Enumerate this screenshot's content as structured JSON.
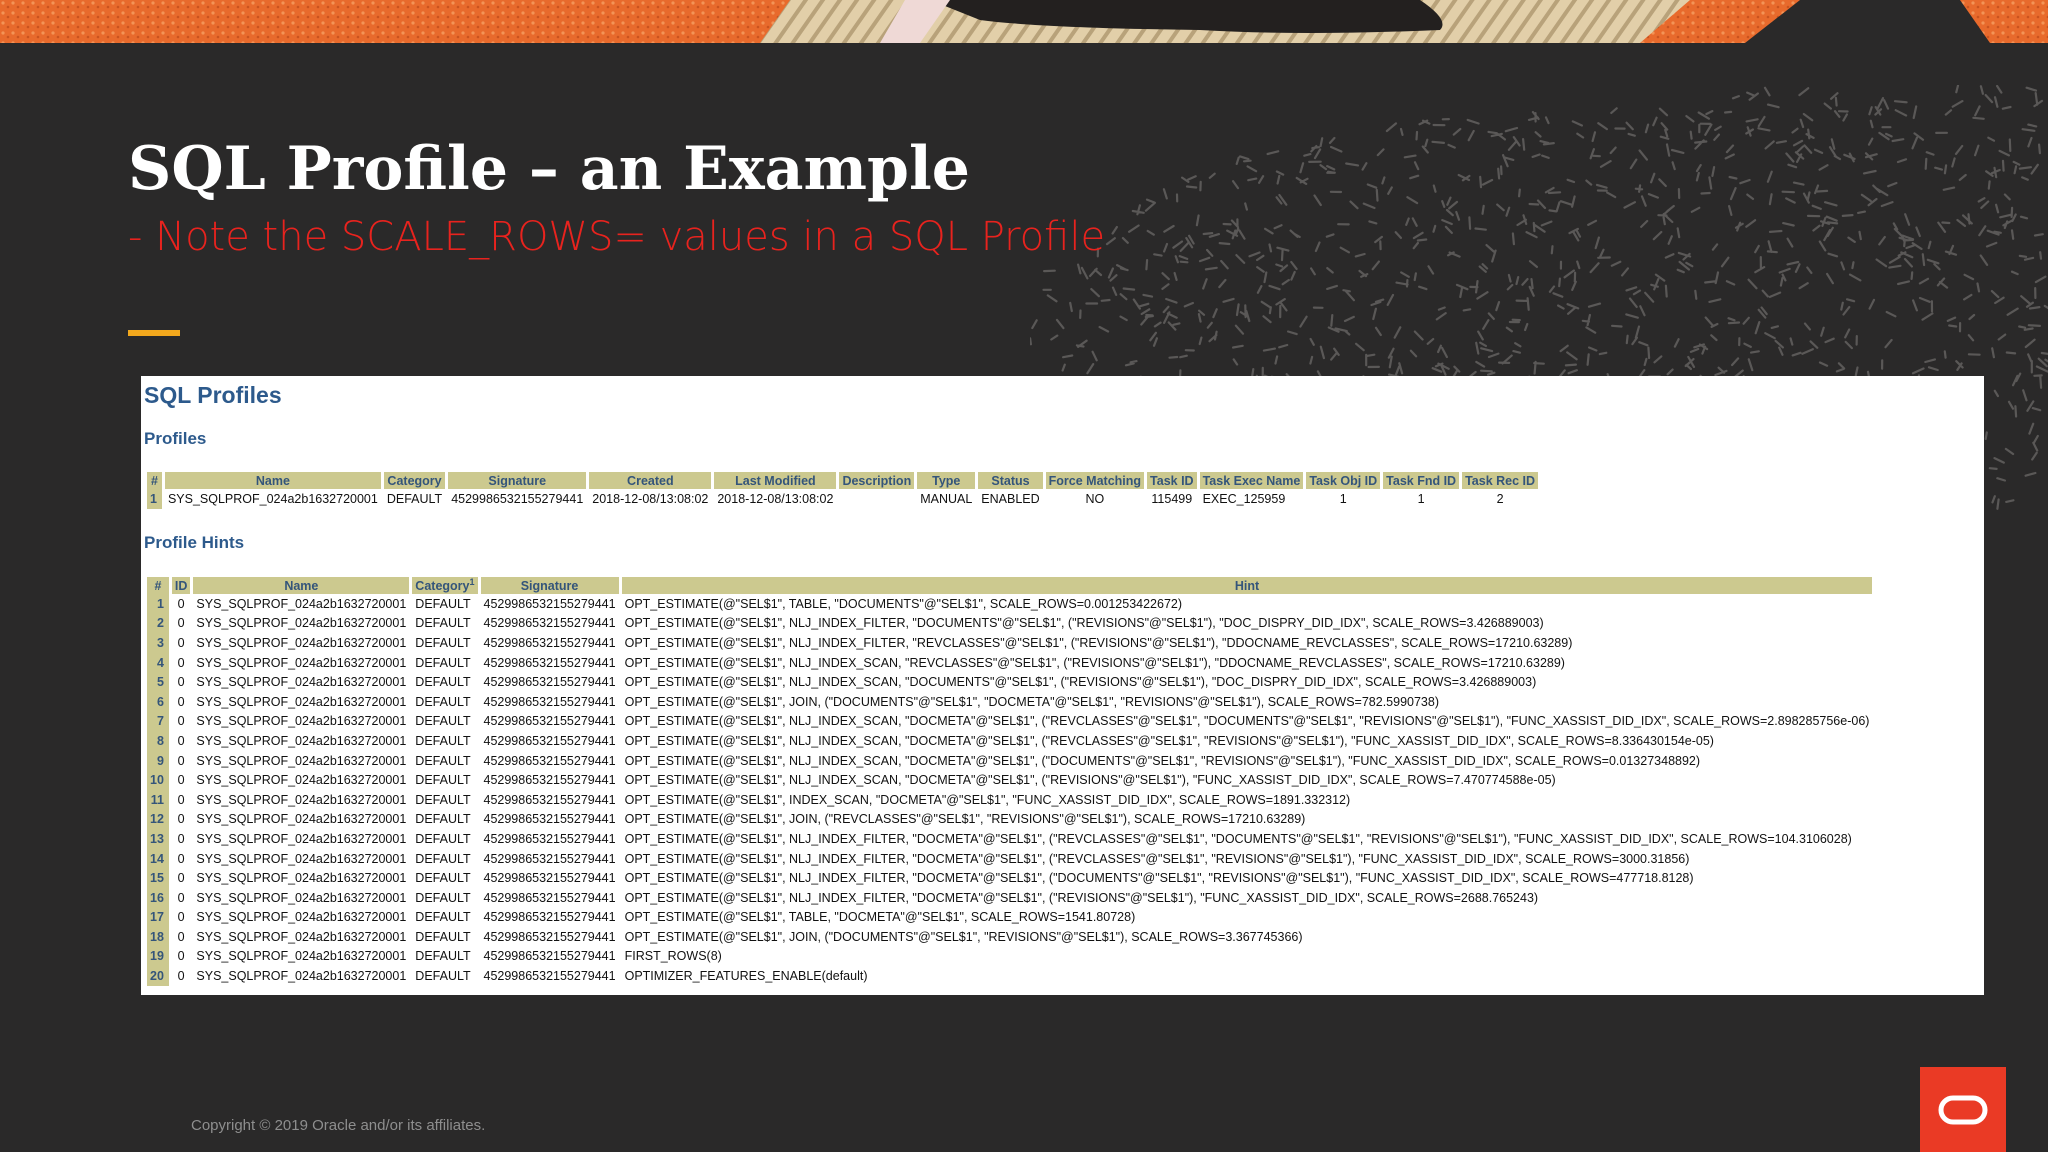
{
  "slide": {
    "title": "SQL Profile – an Example",
    "subtitle": "- Note the SCALE_ROWS= values in a SQL Profile",
    "footer": "Copyright © 2019 Oracle and/or its affiliates.",
    "accent_color": "#f2a81d",
    "subtitle_color": "#e8231e",
    "logo_icon": "oracle-logo-icon"
  },
  "panel": {
    "title": "SQL Profiles",
    "profiles_section": "Profiles",
    "hints_section": "Profile Hints"
  },
  "profiles": {
    "columns": [
      "#",
      "Name",
      "Category",
      "Signature",
      "Created",
      "Last Modified",
      "Description",
      "Type",
      "Status",
      "Force Matching",
      "Task ID",
      "Task Exec Name",
      "Task Obj ID",
      "Task Fnd ID",
      "Task Rec ID"
    ],
    "rows": [
      [
        "1",
        "SYS_SQLPROF_024a2b1632720001",
        "DEFAULT",
        "4529986532155279441",
        "2018-12-08/13:08:02",
        "2018-12-08/13:08:02",
        "",
        "MANUAL",
        "ENABLED",
        "NO",
        "115499",
        "EXEC_125959",
        "1",
        "1",
        "2"
      ]
    ]
  },
  "hints": {
    "columns": [
      "#",
      "ID",
      "Name",
      "Category",
      "Signature",
      "Hint"
    ],
    "category_footnote": "1",
    "rows": [
      [
        "1",
        "0",
        "SYS_SQLPROF_024a2b1632720001",
        "DEFAULT",
        "4529986532155279441",
        "OPT_ESTIMATE(@\"SEL$1\", TABLE, \"DOCUMENTS\"@\"SEL$1\", SCALE_ROWS=0.001253422672)"
      ],
      [
        "2",
        "0",
        "SYS_SQLPROF_024a2b1632720001",
        "DEFAULT",
        "4529986532155279441",
        "OPT_ESTIMATE(@\"SEL$1\", NLJ_INDEX_FILTER, \"DOCUMENTS\"@\"SEL$1\", (\"REVISIONS\"@\"SEL$1\"), \"DOC_DISPRY_DID_IDX\", SCALE_ROWS=3.426889003)"
      ],
      [
        "3",
        "0",
        "SYS_SQLPROF_024a2b1632720001",
        "DEFAULT",
        "4529986532155279441",
        "OPT_ESTIMATE(@\"SEL$1\", NLJ_INDEX_FILTER, \"REVCLASSES\"@\"SEL$1\", (\"REVISIONS\"@\"SEL$1\"), \"DDOCNAME_REVCLASSES\", SCALE_ROWS=17210.63289)"
      ],
      [
        "4",
        "0",
        "SYS_SQLPROF_024a2b1632720001",
        "DEFAULT",
        "4529986532155279441",
        "OPT_ESTIMATE(@\"SEL$1\", NLJ_INDEX_SCAN, \"REVCLASSES\"@\"SEL$1\", (\"REVISIONS\"@\"SEL$1\"), \"DDOCNAME_REVCLASSES\", SCALE_ROWS=17210.63289)"
      ],
      [
        "5",
        "0",
        "SYS_SQLPROF_024a2b1632720001",
        "DEFAULT",
        "4529986532155279441",
        "OPT_ESTIMATE(@\"SEL$1\", NLJ_INDEX_SCAN, \"DOCUMENTS\"@\"SEL$1\", (\"REVISIONS\"@\"SEL$1\"), \"DOC_DISPRY_DID_IDX\", SCALE_ROWS=3.426889003)"
      ],
      [
        "6",
        "0",
        "SYS_SQLPROF_024a2b1632720001",
        "DEFAULT",
        "4529986532155279441",
        "OPT_ESTIMATE(@\"SEL$1\", JOIN, (\"DOCUMENTS\"@\"SEL$1\", \"DOCMETA\"@\"SEL$1\", \"REVISIONS\"@\"SEL$1\"), SCALE_ROWS=782.5990738)"
      ],
      [
        "7",
        "0",
        "SYS_SQLPROF_024a2b1632720001",
        "DEFAULT",
        "4529986532155279441",
        "OPT_ESTIMATE(@\"SEL$1\", NLJ_INDEX_SCAN, \"DOCMETA\"@\"SEL$1\", (\"REVCLASSES\"@\"SEL$1\", \"DOCUMENTS\"@\"SEL$1\", \"REVISIONS\"@\"SEL$1\"), \"FUNC_XASSIST_DID_IDX\", SCALE_ROWS=2.898285756e-06)"
      ],
      [
        "8",
        "0",
        "SYS_SQLPROF_024a2b1632720001",
        "DEFAULT",
        "4529986532155279441",
        "OPT_ESTIMATE(@\"SEL$1\", NLJ_INDEX_SCAN, \"DOCMETA\"@\"SEL$1\", (\"REVCLASSES\"@\"SEL$1\", \"REVISIONS\"@\"SEL$1\"), \"FUNC_XASSIST_DID_IDX\", SCALE_ROWS=8.336430154e-05)"
      ],
      [
        "9",
        "0",
        "SYS_SQLPROF_024a2b1632720001",
        "DEFAULT",
        "4529986532155279441",
        "OPT_ESTIMATE(@\"SEL$1\", NLJ_INDEX_SCAN, \"DOCMETA\"@\"SEL$1\", (\"DOCUMENTS\"@\"SEL$1\", \"REVISIONS\"@\"SEL$1\"), \"FUNC_XASSIST_DID_IDX\", SCALE_ROWS=0.01327348892)"
      ],
      [
        "10",
        "0",
        "SYS_SQLPROF_024a2b1632720001",
        "DEFAULT",
        "4529986532155279441",
        "OPT_ESTIMATE(@\"SEL$1\", NLJ_INDEX_SCAN, \"DOCMETA\"@\"SEL$1\", (\"REVISIONS\"@\"SEL$1\"), \"FUNC_XASSIST_DID_IDX\", SCALE_ROWS=7.470774588e-05)"
      ],
      [
        "11",
        "0",
        "SYS_SQLPROF_024a2b1632720001",
        "DEFAULT",
        "4529986532155279441",
        "OPT_ESTIMATE(@\"SEL$1\", INDEX_SCAN, \"DOCMETA\"@\"SEL$1\", \"FUNC_XASSIST_DID_IDX\", SCALE_ROWS=1891.332312)"
      ],
      [
        "12",
        "0",
        "SYS_SQLPROF_024a2b1632720001",
        "DEFAULT",
        "4529986532155279441",
        "OPT_ESTIMATE(@\"SEL$1\", JOIN, (\"REVCLASSES\"@\"SEL$1\", \"REVISIONS\"@\"SEL$1\"), SCALE_ROWS=17210.63289)"
      ],
      [
        "13",
        "0",
        "SYS_SQLPROF_024a2b1632720001",
        "DEFAULT",
        "4529986532155279441",
        "OPT_ESTIMATE(@\"SEL$1\", NLJ_INDEX_FILTER, \"DOCMETA\"@\"SEL$1\", (\"REVCLASSES\"@\"SEL$1\", \"DOCUMENTS\"@\"SEL$1\", \"REVISIONS\"@\"SEL$1\"), \"FUNC_XASSIST_DID_IDX\", SCALE_ROWS=104.3106028)"
      ],
      [
        "14",
        "0",
        "SYS_SQLPROF_024a2b1632720001",
        "DEFAULT",
        "4529986532155279441",
        "OPT_ESTIMATE(@\"SEL$1\", NLJ_INDEX_FILTER, \"DOCMETA\"@\"SEL$1\", (\"REVCLASSES\"@\"SEL$1\", \"REVISIONS\"@\"SEL$1\"), \"FUNC_XASSIST_DID_IDX\", SCALE_ROWS=3000.31856)"
      ],
      [
        "15",
        "0",
        "SYS_SQLPROF_024a2b1632720001",
        "DEFAULT",
        "4529986532155279441",
        "OPT_ESTIMATE(@\"SEL$1\", NLJ_INDEX_FILTER, \"DOCMETA\"@\"SEL$1\", (\"DOCUMENTS\"@\"SEL$1\", \"REVISIONS\"@\"SEL$1\"), \"FUNC_XASSIST_DID_IDX\", SCALE_ROWS=477718.8128)"
      ],
      [
        "16",
        "0",
        "SYS_SQLPROF_024a2b1632720001",
        "DEFAULT",
        "4529986532155279441",
        "OPT_ESTIMATE(@\"SEL$1\", NLJ_INDEX_FILTER, \"DOCMETA\"@\"SEL$1\", (\"REVISIONS\"@\"SEL$1\"), \"FUNC_XASSIST_DID_IDX\", SCALE_ROWS=2688.765243)"
      ],
      [
        "17",
        "0",
        "SYS_SQLPROF_024a2b1632720001",
        "DEFAULT",
        "4529986532155279441",
        "OPT_ESTIMATE(@\"SEL$1\", TABLE, \"DOCMETA\"@\"SEL$1\", SCALE_ROWS=1541.80728)"
      ],
      [
        "18",
        "0",
        "SYS_SQLPROF_024a2b1632720001",
        "DEFAULT",
        "4529986532155279441",
        "OPT_ESTIMATE(@\"SEL$1\", JOIN, (\"DOCUMENTS\"@\"SEL$1\", \"REVISIONS\"@\"SEL$1\"), SCALE_ROWS=3.367745366)"
      ],
      [
        "19",
        "0",
        "SYS_SQLPROF_024a2b1632720001",
        "DEFAULT",
        "4529986532155279441",
        "FIRST_ROWS(8)"
      ],
      [
        "20",
        "0",
        "SYS_SQLPROF_024a2b1632720001",
        "DEFAULT",
        "4529986532155279441",
        "OPTIMIZER_FEATURES_ENABLE(default)"
      ]
    ]
  }
}
